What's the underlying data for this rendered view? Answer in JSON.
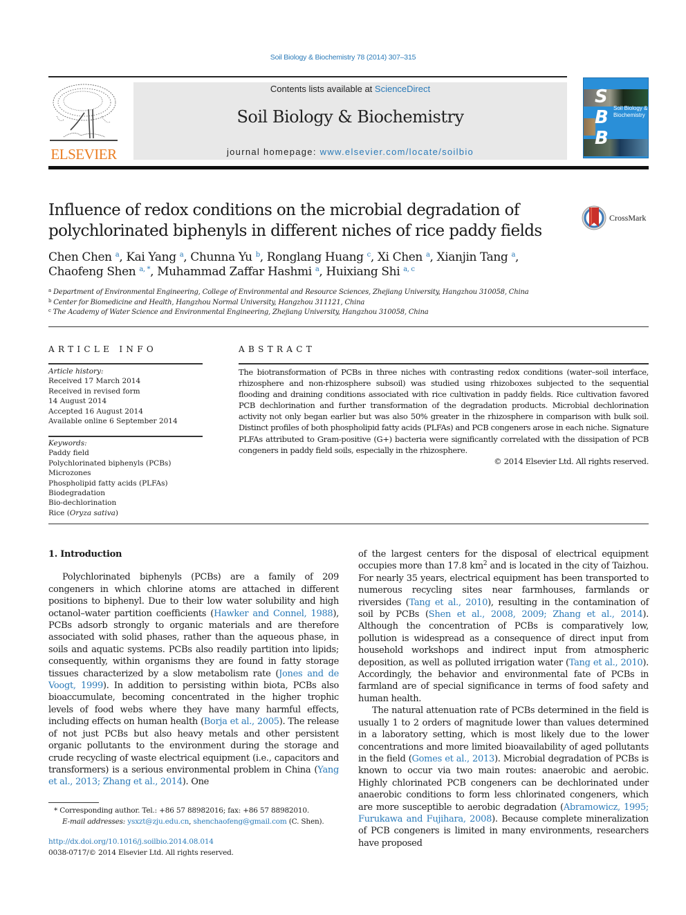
{
  "header": {
    "citation": "Soil Biology & Biochemistry 78 (2014) 307–315",
    "contents_prefix": "Contents lists available at ",
    "contents_link": "ScienceDirect",
    "journal_name": "Soil Biology & Biochemistry",
    "homepage_prefix": "journal homepage: ",
    "homepage_link": "www.elsevier.com/locate/soilbio",
    "publisher_logo_text": "ELSEVIER",
    "cover": {
      "letters": [
        "S",
        "B",
        "B"
      ],
      "title_line1": "Soil Biology &",
      "title_line2": "Biochemistry",
      "background_color": "#2a8fd8"
    },
    "crossmark_label": "CrossMark"
  },
  "article": {
    "title_line1": "Influence of redox conditions on the microbial degradation of",
    "title_line2": "polychlorinated biphenyls in different niches of rice paddy fields",
    "authors": [
      {
        "name": "Chen Chen",
        "affil": "a"
      },
      {
        "name": "Kai Yang",
        "affil": "a"
      },
      {
        "name": "Chunna Yu",
        "affil": "b"
      },
      {
        "name": "Ronglang Huang",
        "affil": "c"
      },
      {
        "name": "Xi Chen",
        "affil": "a"
      },
      {
        "name": "Xianjin Tang",
        "affil": "a"
      },
      {
        "name": "Chaofeng Shen",
        "affil": "a, *"
      },
      {
        "name": "Muhammad Zaffar Hashmi",
        "affil": "a"
      },
      {
        "name": "Huixiang Shi",
        "affil": "a, c"
      }
    ],
    "affiliations": [
      {
        "key": "a",
        "text": "Department of Environmental Engineering, College of Environmental and Resource Sciences, Zhejiang University, Hangzhou 310058, China"
      },
      {
        "key": "b",
        "text": "Center for Biomedicine and Health, Hangzhou Normal University, Hangzhou 311121, China"
      },
      {
        "key": "c",
        "text": "The Academy of Water Science and Environmental Engineering, Zhejiang University, Hangzhou 310058, China"
      }
    ]
  },
  "article_info": {
    "heading": "ARTICLE INFO",
    "history_label": "Article history:",
    "history": [
      "Received 17 March 2014",
      "Received in revised form",
      "14 August 2014",
      "Accepted 16 August 2014",
      "Available online 6 September 2014"
    ],
    "keywords_label": "Keywords:",
    "keywords": [
      "Paddy field",
      "Polychlorinated biphenyls (PCBs)",
      "Microzones",
      "Phospholipid fatty acids (PLFAs)",
      "Biodegradation",
      "Bio-dechlorination"
    ],
    "keyword_last_prefix": "Rice (",
    "keyword_last_italic": "Oryza sativa",
    "keyword_last_suffix": ")"
  },
  "abstract": {
    "heading": "ABSTRACT",
    "text": "The biotransformation of PCBs in three niches with contrasting redox conditions (water–soil interface, rhizosphere and non-rhizosphere subsoil) was studied using rhizoboxes subjected to the sequential flooding and draining conditions associated with rice cultivation in paddy fields. Rice cultivation favored PCB dechlorination and further transformation of the degradation products. Microbial dechlorination activity not only began earlier but was also 50% greater in the rhizosphere in comparison with bulk soil. Distinct profiles of both phospholipid fatty acids (PLFAs) and PCB congeners arose in each niche. Signature PLFAs attributed to Gram-positive (G+) bacteria were significantly correlated with the dissipation of PCB congeners in paddy field soils, especially in the rhizosphere.",
    "copyright": "© 2014 Elsevier Ltd. All rights reserved."
  },
  "body": {
    "section_heading": "1.  Introduction",
    "left_para": [
      {
        "t": "Polychlorinated biphenyls (PCBs) are a family of 209 congeners in which chlorine atoms are attached in different positions to biphenyl. Due to their low water solubility and high octanol–water partition coefficients ("
      },
      {
        "link": "Hawker and Connel, 1988"
      },
      {
        "t": "), PCBs adsorb strongly to organic materials and are therefore associated with solid phases, rather than the aqueous phase, in soils and aquatic systems. PCBs also readily partition into lipids; consequently, within organisms they are found in fatty storage tissues characterized by a slow metabolism rate ("
      },
      {
        "link": "Jones and de Voogt, 1999"
      },
      {
        "t": "). In addition to persisting within biota, PCBs also bioaccumulate, becoming concentrated in the higher trophic levels of food webs where they have many harmful effects, including effects on human health ("
      },
      {
        "link": "Borja et al., 2005"
      },
      {
        "t": "). The release of not just PCBs but also heavy metals and other persistent organic pollutants to the environment during the storage and crude recycling of waste electrical equipment (i.e., capacitors and transformers) is a serious environmental problem in China ("
      },
      {
        "link": "Yang et al., 2013; Zhang et al., 2014"
      },
      {
        "t": "). One"
      }
    ],
    "right_para1": [
      {
        "t": "of the largest centers for the disposal of electrical equipment occupies more than 17.8 km"
      },
      {
        "sup": "2"
      },
      {
        "t": " and is located in the city of Taizhou. For nearly 35 years, electrical equipment has been transported to numerous recycling sites near farmhouses, farmlands or riversides ("
      },
      {
        "link": "Tang et al., 2010"
      },
      {
        "t": "), resulting in the contamination of soil by PCBs ("
      },
      {
        "link": "Shen et al., 2008, 2009; Zhang et al., 2014"
      },
      {
        "t": "). Although the concentration of PCBs is comparatively low, pollution is widespread as a consequence of direct input from household workshops and indirect input from atmospheric deposition, as well as polluted irrigation water ("
      },
      {
        "link": "Tang et al., 2010"
      },
      {
        "t": "). Accordingly, the behavior and environmental fate of PCBs in farmland are of special significance in terms of food safety and human health."
      }
    ],
    "right_para2": [
      {
        "t": "The natural attenuation rate of PCBs determined in the field is usually 1 to 2 orders of magnitude lower than values determined in a laboratory setting, which is most likely due to the lower concentrations and more limited bioavailability of aged pollutants in the field ("
      },
      {
        "link": "Gomes et al., 2013"
      },
      {
        "t": "). Microbial degradation of PCBs is known to occur via two main routes: anaerobic and aerobic. Highly chlorinated PCB congeners can be dechlorinated under anaerobic conditions to form less chlorinated congeners, which are more susceptible to aerobic degradation ("
      },
      {
        "link": "Abramowicz, 1995; Furukawa and Fujihara, 2008"
      },
      {
        "t": "). Because complete mineralization of PCB congeners is limited in many environments, researchers have proposed"
      }
    ]
  },
  "footnote": {
    "marker": "*",
    "corresponding": "Corresponding author. Tel.: +86 57 88982016; fax: +86 57 88982010.",
    "email_label": "E-mail addresses:",
    "email1": "ysxzt@zju.edu.cn",
    "email2": "shenchaofeng@gmail.com",
    "email_suffix": " (C. Shen).",
    "doi": "http://dx.doi.org/10.1016/j.soilbio.2014.08.014",
    "issn_line": "0038-0717/© 2014 Elsevier Ltd. All rights reserved."
  },
  "colors": {
    "link": "#2a7ab8",
    "elsevier_orange": "#ea7d22",
    "banner_gray": "#e8e8e8"
  }
}
